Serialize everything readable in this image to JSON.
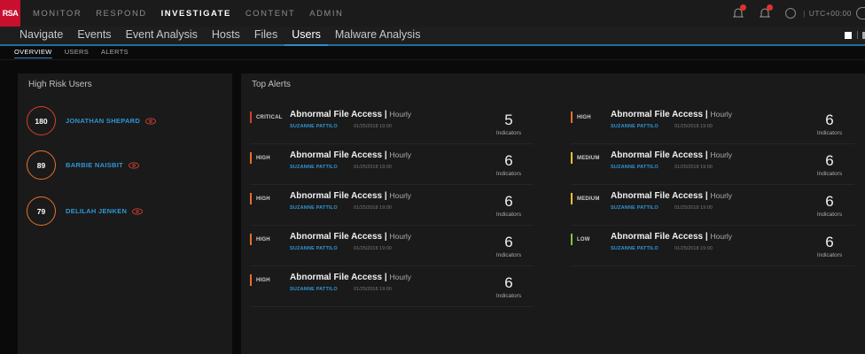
{
  "app": {
    "logo": "RSA"
  },
  "top_nav": [
    "MONITOR",
    "RESPOND",
    "INVESTIGATE",
    "CONTENT",
    "ADMIN"
  ],
  "top_nav_active": "INVESTIGATE",
  "top_right": {
    "timezone": "UTC+00:00"
  },
  "sub_nav": [
    "Navigate",
    "Events",
    "Event Analysis",
    "Hosts",
    "Files",
    "Users",
    "Malware Analysis"
  ],
  "sub_nav_active": "Users",
  "tabs": [
    "OVERVIEW",
    "USERS",
    "ALERTS"
  ],
  "high_risk": {
    "title": "High Risk Users",
    "users": [
      {
        "score": "180",
        "name": "JONATHAN SHEPARD",
        "level": "red"
      },
      {
        "score": "89",
        "name": "BARBIE NAISBIT",
        "level": "orange"
      },
      {
        "score": "79",
        "name": "DELILAH JENKEN",
        "level": "orange"
      }
    ]
  },
  "top_alerts": {
    "title": "Top Alerts",
    "indicators_label": "Indicators",
    "left": [
      {
        "severity": "CRITICAL",
        "color": "#d2402e",
        "name": "Abnormal File Access",
        "freq": "Hourly",
        "user": "SUZANNE PATTILO",
        "date": "01/25/2018 19:00",
        "count": "5"
      },
      {
        "severity": "HIGH",
        "color": "#e8702a",
        "name": "Abnormal File Access",
        "freq": "Hourly",
        "user": "SUZANNE PATTILO",
        "date": "01/25/2018 19:00",
        "count": "6"
      },
      {
        "severity": "HIGH",
        "color": "#e8702a",
        "name": "Abnormal File Access",
        "freq": "Hourly",
        "user": "SUZANNE PATTILO",
        "date": "01/25/2018 19:00",
        "count": "6"
      },
      {
        "severity": "HIGH",
        "color": "#e8702a",
        "name": "Abnormal File Access",
        "freq": "Hourly",
        "user": "SUZANNE PATTILO",
        "date": "01/25/2018 19:00",
        "count": "6"
      },
      {
        "severity": "HIGH",
        "color": "#e8702a",
        "name": "Abnormal File Access",
        "freq": "Hourly",
        "user": "SUZANNE PATTILO",
        "date": "01/25/2018 19:00",
        "count": "6"
      }
    ],
    "right": [
      {
        "severity": "HIGH",
        "color": "#e8702a",
        "name": "Abnormal File Access",
        "freq": "Hourly",
        "user": "SUZANNE PATTILO",
        "date": "01/25/2018 19:00",
        "count": "6"
      },
      {
        "severity": "MEDIUM",
        "color": "#f2c12e",
        "name": "Abnormal File Access",
        "freq": "Hourly",
        "user": "SUZANNE PATTILO",
        "date": "01/25/2018 19:00",
        "count": "6"
      },
      {
        "severity": "MEDIUM",
        "color": "#f2c12e",
        "name": "Abnormal File Access",
        "freq": "Hourly",
        "user": "SUZANNE PATTILO",
        "date": "01/25/2018 19:00",
        "count": "6"
      },
      {
        "severity": "LOW",
        "color": "#7ac943",
        "name": "Abnormal File Access",
        "freq": "Hourly",
        "user": "SUZANNE PATTILO",
        "date": "01/25/2018 19:00",
        "count": "6"
      }
    ]
  }
}
